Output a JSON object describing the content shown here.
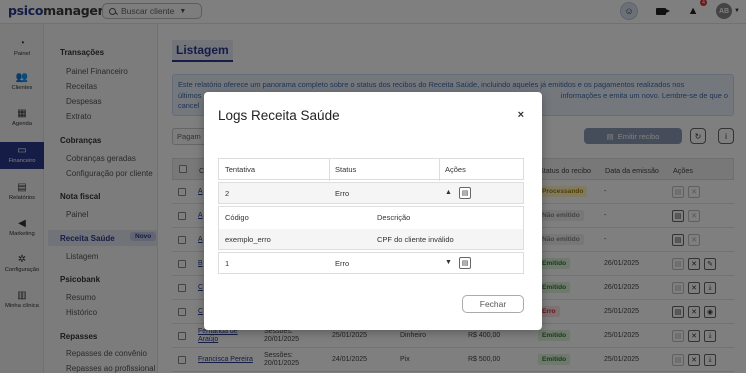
{
  "app": {
    "logo_part1": "psico",
    "logo_part2": "manager",
    "search_placeholder": "Buscar cliente",
    "notification_count": "4",
    "user_initials": "AB"
  },
  "rail": [
    {
      "label": "Painel",
      "icon": "gauge-icon"
    },
    {
      "label": "Clientes",
      "icon": "users-icon"
    },
    {
      "label": "Agenda",
      "icon": "calendar-icon"
    },
    {
      "label": "Financeiro",
      "icon": "money-icon"
    },
    {
      "label": "Relatórios",
      "icon": "report-icon"
    },
    {
      "label": "Marketing",
      "icon": "megaphone-icon"
    },
    {
      "label": "Configuração",
      "icon": "gear-icon"
    },
    {
      "label": "Minha clínica",
      "icon": "building-icon"
    }
  ],
  "submenu": {
    "transacoes": "Transações",
    "painel_financeiro": "Painel Financeiro",
    "receitas": "Receitas",
    "despesas": "Despesas",
    "extrato": "Extrato",
    "cobrancas": "Cobranças",
    "cobrancas_geradas": "Cobranças geradas",
    "configuracao_cobranca": "Configuração por cliente",
    "nota_fiscal": "Nota fiscal",
    "nf_painel": "Painel",
    "receita_saude": "Receita Saúde",
    "novo": "Novo",
    "listagem": "Listagem",
    "psicobank": "Psicobank",
    "resumo": "Resumo",
    "historico": "Histórico",
    "repasses": "Repasses",
    "repasses_convenio": "Repasses de convênio",
    "repasses_profissional": "Repasses ao profissional"
  },
  "main": {
    "title": "Listagem",
    "info_line1": "Este relatório oferece um panorama completo sobre o status dos recibos do Receita Saúde, incluindo aqueles já emitidos e os pagamentos realizados nos",
    "info_line2_left": "últimos",
    "info_line2_right": "informações e emita um novo. Lembre-se de que o",
    "info_line3": "cancel",
    "filter_label": "Pagam",
    "emit_button": "Emitir recibo",
    "headers": {
      "col_c": "C",
      "status": "Status do recibo",
      "data_emissao": "Data da emissão",
      "acoes": "Ações"
    },
    "rows": [
      {
        "name": "A",
        "status": "Processando",
        "date": "-"
      },
      {
        "name": "A",
        "status": "Não emitido",
        "date": "-"
      },
      {
        "name": "A",
        "status": "Não emitido",
        "date": "-"
      },
      {
        "name": "B",
        "status": "Emitido",
        "date": "26/01/2025"
      },
      {
        "name": "C",
        "status": "Emitido",
        "date": "26/01/2025"
      },
      {
        "name": "C",
        "status": "Erro",
        "date": "25/01/2025"
      },
      {
        "name": "Fernanda de Araújo",
        "sessions": "Sessões: 20/01/2025",
        "date_ref": "25/01/2025",
        "method": "Dinheiro",
        "amount": "R$ 400,00",
        "status": "Emitido",
        "date": "25/01/2025"
      },
      {
        "name": "Francisca Pereira",
        "sessions": "Sessões: 20/01/2025",
        "date_ref": "24/01/2025",
        "method": "Pix",
        "amount": "R$ 500,00",
        "status": "Emitido",
        "date": "25/01/2025"
      }
    ]
  },
  "modal": {
    "title": "Logs Receita Saúde",
    "close": "×",
    "headers": {
      "tentativa": "Tentativa",
      "status": "Status",
      "acoes": "Ações"
    },
    "row_a": {
      "tentativa": "2",
      "status": "Erro"
    },
    "detail_headers": {
      "codigo": "Código",
      "descricao": "Descrição"
    },
    "detail_values": {
      "codigo": "exemplo_erro",
      "descricao": "CPF do cliente inválido"
    },
    "row_b": {
      "tentativa": "1",
      "status": "Erro"
    },
    "close_button": "Fechar"
  }
}
